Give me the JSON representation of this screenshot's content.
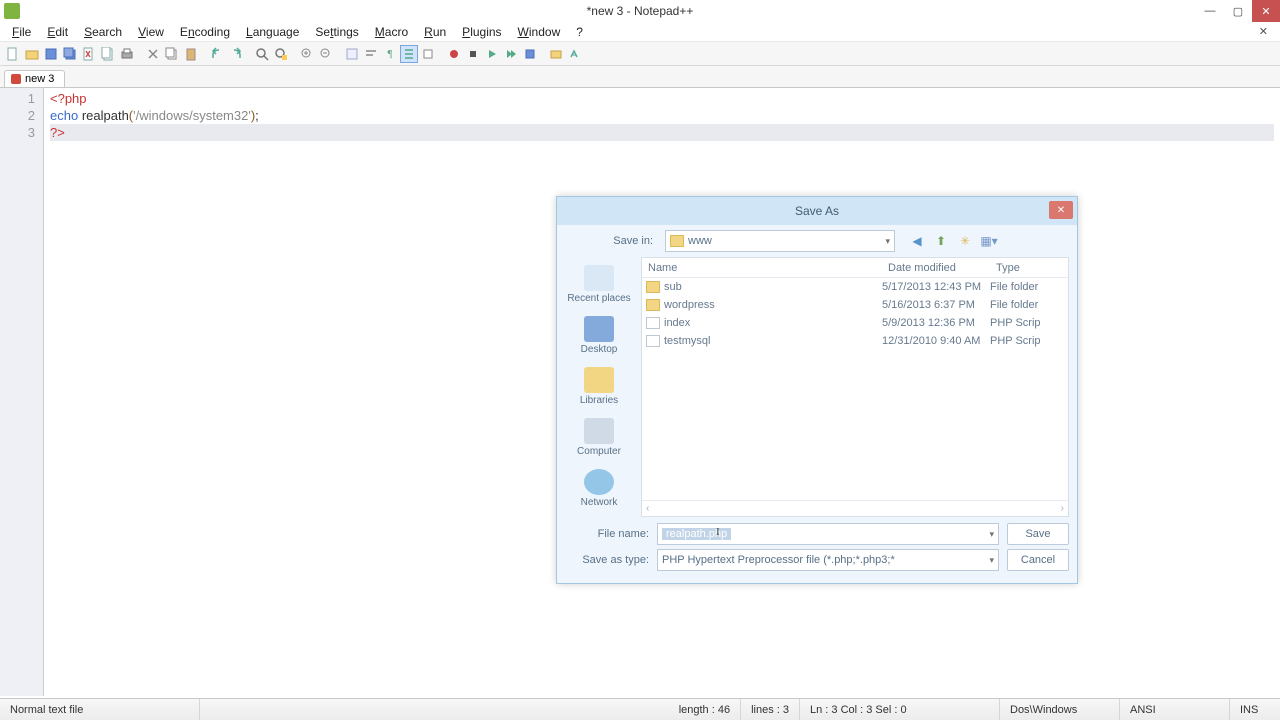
{
  "window": {
    "title": "*new  3 - Notepad++"
  },
  "menus": [
    "File",
    "Edit",
    "Search",
    "View",
    "Encoding",
    "Language",
    "Settings",
    "Macro",
    "Run",
    "Plugins",
    "Window",
    "?"
  ],
  "tab": {
    "label": "new  3"
  },
  "code": {
    "lines": [
      "1",
      "2",
      "3"
    ],
    "l1_a": "<?php",
    "l2_a": "echo",
    "l2_b": " realpath",
    "l2_c": "(",
    "l2_d": "'/windows/system32'",
    "l2_e": ")",
    "l2_f": ";",
    "l3_a": "?>"
  },
  "status": {
    "left": "Normal text file",
    "length": "length : 46",
    "lines": "lines : 3",
    "pos": "Ln : 3    Col : 3    Sel : 0",
    "eol": "Dos\\Windows",
    "enc": "ANSI",
    "ins": "INS"
  },
  "saveas": {
    "title": "Save As",
    "savein_label": "Save in:",
    "savein_value": "www",
    "headers": {
      "name": "Name",
      "date": "Date modified",
      "type": "Type"
    },
    "places": [
      "Recent places",
      "Desktop",
      "Libraries",
      "Computer",
      "Network"
    ],
    "rows": [
      {
        "icon": "folder",
        "name": "sub",
        "date": "5/17/2013 12:43 PM",
        "type": "File folder"
      },
      {
        "icon": "folder",
        "name": "wordpress",
        "date": "5/16/2013 6:37 PM",
        "type": "File folder"
      },
      {
        "icon": "file",
        "name": "index",
        "date": "5/9/2013 12:36 PM",
        "type": "PHP Scrip"
      },
      {
        "icon": "file",
        "name": "testmysql",
        "date": "12/31/2010 9:40 AM",
        "type": "PHP Scrip"
      }
    ],
    "filename_label": "File name:",
    "filename_value": "realpath.php",
    "savetype_label": "Save as type:",
    "savetype_value": "PHP Hypertext Preprocessor file (*.php;*.php3;*",
    "save": "Save",
    "cancel": "Cancel"
  }
}
